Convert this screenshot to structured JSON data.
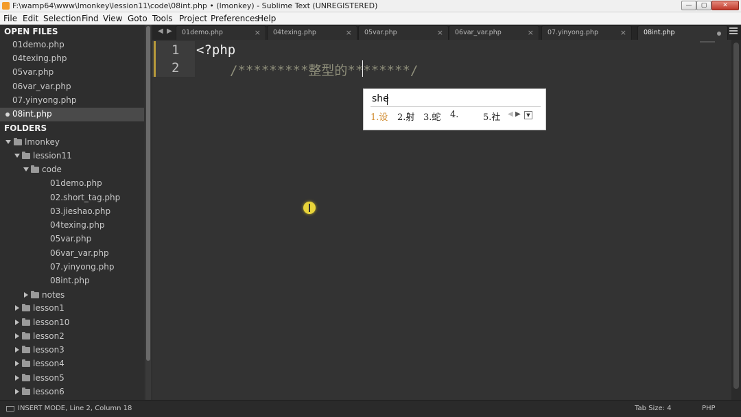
{
  "window": {
    "title": "F:\\wamp64\\www\\lmonkey\\lession11\\code\\08int.php • (lmonkey) - Sublime Text (UNREGISTERED)",
    "controls": {
      "minimize": "—",
      "maximize": "▢",
      "close": "✕"
    }
  },
  "menu": [
    "File",
    "Edit",
    "Selection",
    "Find",
    "View",
    "Goto",
    "Tools",
    "Project",
    "Preferences",
    "Help"
  ],
  "sidebar": {
    "open_files_heading": "OPEN FILES",
    "open_files": [
      "01demo.php",
      "04texing.php",
      "05var.php",
      "06var_var.php",
      "07.yinyong.php",
      "08int.php"
    ],
    "active_open_file": "08int.php",
    "folders_heading": "FOLDERS",
    "root": "lmonkey",
    "lession11": "lession11",
    "code": "code",
    "code_files": [
      "01demo.php",
      "02.short_tag.php",
      "03.jieshao.php",
      "04texing.php",
      "05var.php",
      "06var_var.php",
      "07.yinyong.php",
      "08int.php"
    ],
    "notes": "notes",
    "lessons": [
      "lesson1",
      "lesson10",
      "lesson2",
      "lesson3",
      "lesson4",
      "lesson5",
      "lesson6"
    ]
  },
  "tabs": [
    {
      "label": "01demo.php"
    },
    {
      "label": "04texing.php"
    },
    {
      "label": "05var.php"
    },
    {
      "label": "06var_var.php"
    },
    {
      "label": "07.yinyong.php"
    },
    {
      "label": "08int.php"
    }
  ],
  "tab_nav": {
    "prev": "◀",
    "next": "▶"
  },
  "editor": {
    "line_numbers": [
      "1",
      "2"
    ],
    "line1": "<?php",
    "line2": "/*********整型的********/"
  },
  "ime": {
    "composition": "she",
    "candidates": [
      "1.设",
      "2.射",
      "3.蛇",
      "4.",
      "5.社"
    ],
    "nav_prev": "◀",
    "nav_next": "▶",
    "dropdown": "▼"
  },
  "status": {
    "left": "INSERT MODE, Line 2, Column 18",
    "tab_size": "Tab Size: 4",
    "syntax": "PHP"
  },
  "colors": {
    "background": "#333333",
    "sidebar": "#2e2e2e",
    "comment": "#8e8e7a",
    "ime_first_candidate": "#d08a2c"
  }
}
